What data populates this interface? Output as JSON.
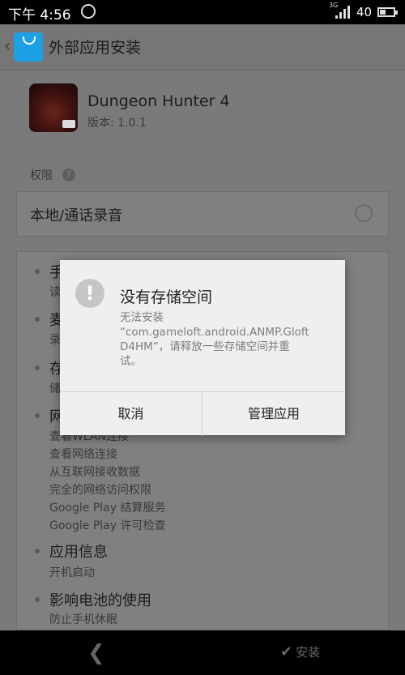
{
  "status_bar": {
    "time": "下午 4:56",
    "network_type": "3G",
    "battery": "40"
  },
  "header": {
    "title": "外部应用安装",
    "app_store_icon": "app-store-bag-icon"
  },
  "app": {
    "name": "Dungeon Hunter 4",
    "version": "版本: 1.0.1",
    "icon": "dungeon-hunter-icon"
  },
  "permissions_label": "权限",
  "highlighted_permission": "本地/通话录音",
  "permission_groups": [
    {
      "title": "手",
      "items": [
        "读"
      ]
    },
    {
      "title": "麦",
      "items": [
        "录"
      ]
    },
    {
      "title": "存",
      "items": [
        "储"
      ]
    },
    {
      "title": "网",
      "items": [
        "查看WLAN连接",
        "查看网络连接",
        "从互联网接收数据",
        "完全的网络访问权限",
        "Google Play 结算服务",
        "Google Play 许可检查"
      ]
    },
    {
      "title": "应用信息",
      "items": [
        "开机启动"
      ]
    },
    {
      "title": "影响电池的使用",
      "items": [
        "防止手机休眠"
      ]
    }
  ],
  "dialog": {
    "title": "没有存储空间",
    "message_lines": [
      "无法安装",
      "“com.gameloft.android.ANMP.Gloft",
      "D4HM”，请释放一些存储空间并重",
      "试。"
    ],
    "cancel_label": "取消",
    "manage_label": "管理应用"
  },
  "nav": {
    "install_label": "安装"
  },
  "colors": {
    "dialog_bg": "#efefef",
    "scrim": "#7a7a7a",
    "accent": "#1ea0e6"
  }
}
